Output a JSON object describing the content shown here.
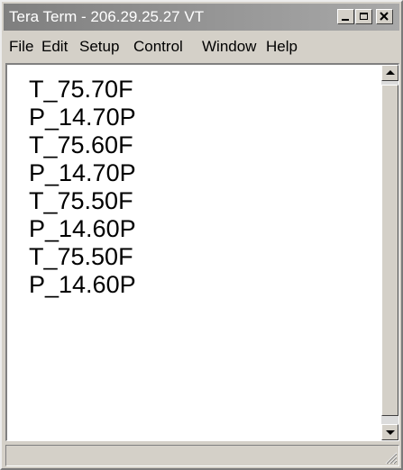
{
  "window": {
    "title": "Tera Term - 206.29.25.27 VT",
    "controls": [
      "minimize-icon",
      "maximize-icon",
      "close-icon"
    ]
  },
  "menu": {
    "items": [
      {
        "label": "File"
      },
      {
        "label": "Edit"
      },
      {
        "label": "Setup"
      },
      {
        "label": "Control"
      },
      {
        "label": "Window"
      },
      {
        "label": "Help"
      }
    ]
  },
  "terminal": {
    "lines": [
      "T_75.70F",
      "P_14.70P",
      "T_75.60F",
      "P_14.70P",
      "T_75.50F",
      "P_14.60P",
      "T_75.50F",
      "P_14.60P"
    ]
  },
  "colors": {
    "title_bar": "#7f7f7f",
    "chrome": "#d4d0c8",
    "terminal_background": "#ffffff",
    "terminal_text": "#000000"
  }
}
